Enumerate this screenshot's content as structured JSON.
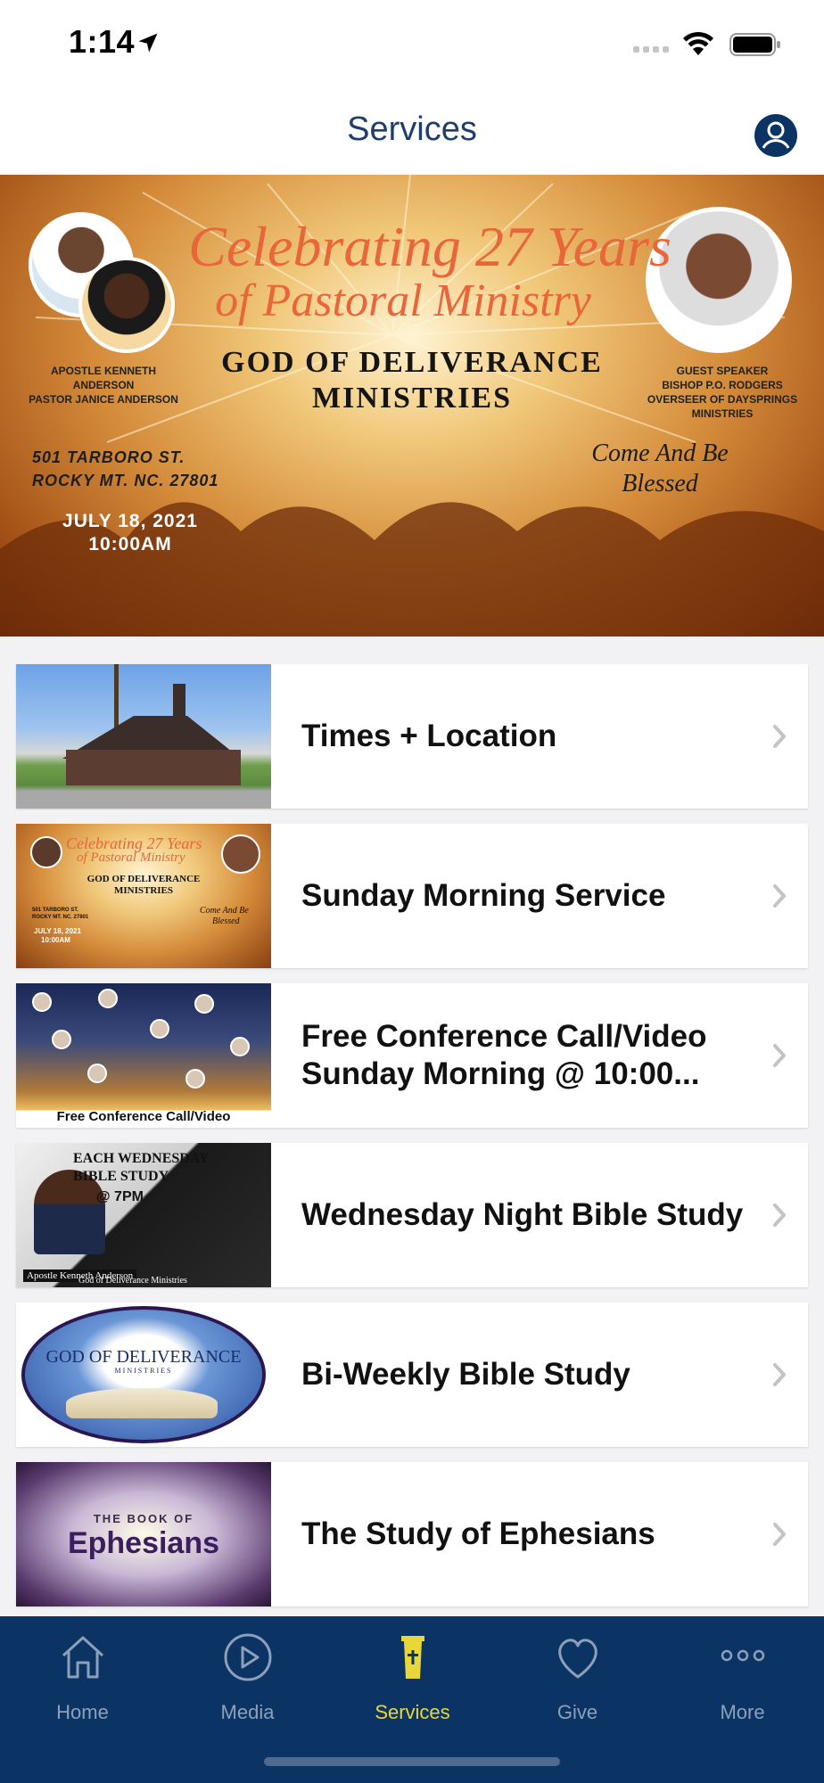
{
  "status": {
    "time": "1:14"
  },
  "header": {
    "title": "Services"
  },
  "banner": {
    "script_line1": "Celebrating 27 Years",
    "script_line2": "of Pastoral Ministry",
    "org_line1": "GOD OF DELIVERANCE",
    "org_line2": "MINISTRIES",
    "left_caption_line1": "APOSTLE KENNETH ANDERSON",
    "left_caption_line2": "PASTOR JANICE ANDERSON",
    "right_caption_line1": "GUEST SPEAKER",
    "right_caption_line2": "BISHOP P.O. RODGERS",
    "right_caption_line3": "OVERSEER OF DAYSPRINGS",
    "right_caption_line4": "MINISTRIES",
    "address_line1": "501 TARBORO ST.",
    "address_line2": "ROCKY MT. NC. 27801",
    "date_line1": "JULY 18, 2021",
    "date_line2": "10:00AM",
    "blessed_line1": "Come And Be",
    "blessed_line2": "Blessed"
  },
  "services": [
    {
      "label": "Times + Location"
    },
    {
      "label": "Sunday Morning Service"
    },
    {
      "label": "Free Conference Call/Video Sunday Morning @ 10:00..."
    },
    {
      "label": "Wednesday Night Bible Study"
    },
    {
      "label": "Bi-Weekly Bible Study"
    },
    {
      "label": "The Study of Ephesians"
    }
  ],
  "thumbs": {
    "sunday_script1": "Celebrating 27 Years",
    "sunday_script2": "of Pastoral Ministry",
    "sunday_org1": "GOD OF DELIVERANCE",
    "sunday_org2": "MINISTRIES",
    "sunday_bless1": "Come And Be",
    "sunday_bless2": "Blessed",
    "sunday_addr1": "501 TARBORO ST.",
    "sunday_addr2": "ROCKY MT. NC. 27801",
    "sunday_date1": "JULY 18, 2021",
    "sunday_date2": "10:00AM",
    "conference_caption": "Free Conference Call/Video",
    "bible_line1": "EACH WEDNESDAY",
    "bible_line2": "BIBLE STUDY",
    "bible_line3": "@ 7PM",
    "bible_pastor": "Apostle Kenneth Anderson",
    "bible_org": "God of Deliverance Ministries",
    "gdm_line1": "GOD OF DELIVERANCE",
    "gdm_line2": "MINISTRIES",
    "eph_line1": "THE BOOK OF",
    "eph_line2": "Ephesians"
  },
  "tabs": [
    {
      "label": "Home",
      "icon": "home-icon",
      "active": false
    },
    {
      "label": "Media",
      "icon": "play-icon",
      "active": false
    },
    {
      "label": "Services",
      "icon": "pulpit-icon",
      "active": true
    },
    {
      "label": "Give",
      "icon": "heart-icon",
      "active": false
    },
    {
      "label": "More",
      "icon": "more-dots-icon",
      "active": false
    }
  ],
  "colors": {
    "accent": "#1e3e6c",
    "tab_bar_bg": "#0b3464",
    "tab_active": "#e9d73a",
    "tab_inactive": "#8da0b9"
  }
}
